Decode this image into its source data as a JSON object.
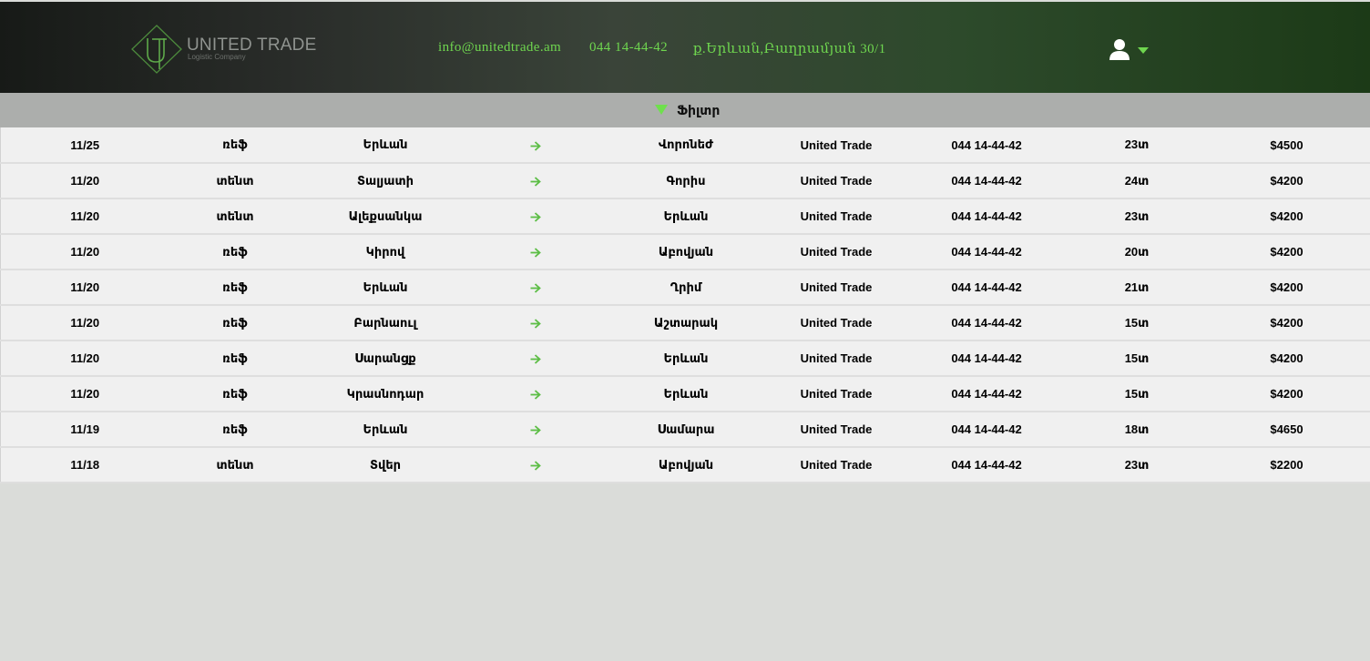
{
  "header": {
    "logo": {
      "brand": "UNITED TRADE",
      "tagline": "Logistic Company",
      "monogram": "UT"
    },
    "email": "info@unitedtrade.am",
    "phone": "044 14-44-42",
    "address": "ք.Երևան,Բաղրամյան 30/1",
    "user_icon": "user-icon",
    "dropdown_icon": "caret-down-icon"
  },
  "filter": {
    "label": "Ֆիլտր",
    "icon": "filter-triangle-icon"
  },
  "colors": {
    "accent": "#6fd64f",
    "company": "#5cbd45",
    "filterbar": "#acaeac",
    "row": "#f0f0f0"
  },
  "rows": [
    {
      "date": "11/25",
      "type": "ռեֆ",
      "from": "Երևան",
      "to": "Վորոնեժ",
      "company": "United Trade",
      "phone": "044 14-44-42",
      "weight": "23տ",
      "price": "$4500"
    },
    {
      "date": "11/20",
      "type": "տենտ",
      "from": "Տալյատի",
      "to": "Գորիս",
      "company": "United Trade",
      "phone": "044 14-44-42",
      "weight": "24տ",
      "price": "$4200"
    },
    {
      "date": "11/20",
      "type": "տենտ",
      "from": "Ալեքսանկա",
      "to": "Երևան",
      "company": "United Trade",
      "phone": "044 14-44-42",
      "weight": "23տ",
      "price": "$4200"
    },
    {
      "date": "11/20",
      "type": "ռեֆ",
      "from": "Կիրով",
      "to": "Աբովյան",
      "company": "United Trade",
      "phone": "044 14-44-42",
      "weight": "20տ",
      "price": "$4200"
    },
    {
      "date": "11/20",
      "type": "ռեֆ",
      "from": "Երևան",
      "to": "Ղրիմ",
      "company": "United Trade",
      "phone": "044 14-44-42",
      "weight": "21տ",
      "price": "$4200"
    },
    {
      "date": "11/20",
      "type": "ռեֆ",
      "from": "Բարնաուլ",
      "to": "Աշտարակ",
      "company": "United Trade",
      "phone": "044 14-44-42",
      "weight": "15տ",
      "price": "$4200"
    },
    {
      "date": "11/20",
      "type": "ռեֆ",
      "from": "Սարանցք",
      "to": "Երևան",
      "company": "United Trade",
      "phone": "044 14-44-42",
      "weight": "15տ",
      "price": "$4200"
    },
    {
      "date": "11/20",
      "type": "ռեֆ",
      "from": "Կրասնոդար",
      "to": "Երևան",
      "company": "United Trade",
      "phone": "044 14-44-42",
      "weight": "15տ",
      "price": "$4200"
    },
    {
      "date": "11/19",
      "type": "ռեֆ",
      "from": "Երևան",
      "to": "Սամարա",
      "company": "United Trade",
      "phone": "044 14-44-42",
      "weight": "18տ",
      "price": "$4650"
    },
    {
      "date": "11/18",
      "type": "տենտ",
      "from": "Տվեր",
      "to": "Աբովյան",
      "company": "United Trade",
      "phone": "044 14-44-42",
      "weight": "23տ",
      "price": "$2200"
    }
  ]
}
